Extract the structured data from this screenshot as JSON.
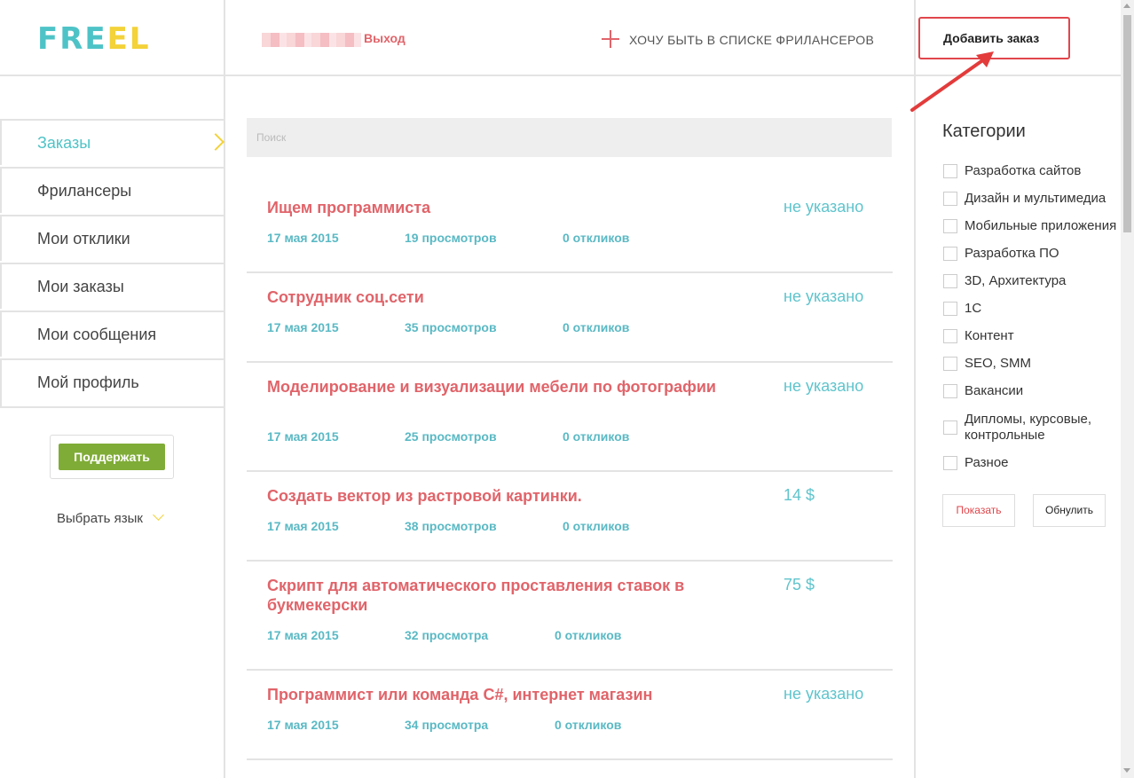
{
  "header": {
    "logo_left": "FRE",
    "logo_e": "E",
    "logo_right": "L",
    "logout": "Выход",
    "want_freelancers": "ХОЧУ БЫТЬ В СПИСКЕ ФРИЛАНСЕРОВ",
    "add_order": "Добавить заказ"
  },
  "sidebar": {
    "items": [
      {
        "label": "Заказы",
        "active": true
      },
      {
        "label": "Фрилансеры"
      },
      {
        "label": "Мои отклики"
      },
      {
        "label": "Мои заказы"
      },
      {
        "label": "Мои сообщения"
      },
      {
        "label": "Мой профиль"
      }
    ],
    "support": "Поддержать",
    "language": "Выбрать язык"
  },
  "search": {
    "placeholder": "Поиск"
  },
  "orders": [
    {
      "title": "Ищем программиста",
      "price": "не указано",
      "date": "17 мая 2015",
      "views": "19 просмотров",
      "responses": "0 откликов"
    },
    {
      "title": "Сотрудник соц.сети",
      "price": "не указано",
      "date": "17 мая 2015",
      "views": "35 просмотров",
      "responses": "0 откликов"
    },
    {
      "title": "Моделирование и визуализации мебели по фотографии",
      "price": "не указано",
      "date": "17 мая 2015",
      "views": "25 просмотров",
      "responses": "0 откликов"
    },
    {
      "title": "Создать вектор из растровой картинки.",
      "price": "14 $",
      "date": "17 мая 2015",
      "views": "38 просмотров",
      "responses": "0 откликов"
    },
    {
      "title": "Скрипт для автоматического проставления ставок в букмекерски",
      "price": "75 $",
      "date": "17 мая 2015",
      "views": "32 просмотра",
      "responses": "0 откликов"
    },
    {
      "title": "Программист или команда C#, интернет магазин",
      "price": "не указано",
      "date": "17 мая 2015",
      "views": "34 просмотра",
      "responses": "0 откликов"
    }
  ],
  "categories": {
    "title": "Категории",
    "items": [
      "Разработка сайтов",
      "Дизайн и мультимедиа",
      "Мобильные приложения",
      "Разработка ПО",
      "3D, Архитектура",
      "1С",
      "Контент",
      "SEO, SMM",
      "Вакансии",
      "Дипломы, курсовые, контрольные",
      "Разное"
    ],
    "show": "Показать",
    "reset": "Обнулить"
  },
  "colors": {
    "accent_teal": "#4ec3c7",
    "accent_red": "#e0646a",
    "accent_yellow": "#f3d23a",
    "support_green": "#7fac36",
    "highlight_red": "#e0464b"
  }
}
